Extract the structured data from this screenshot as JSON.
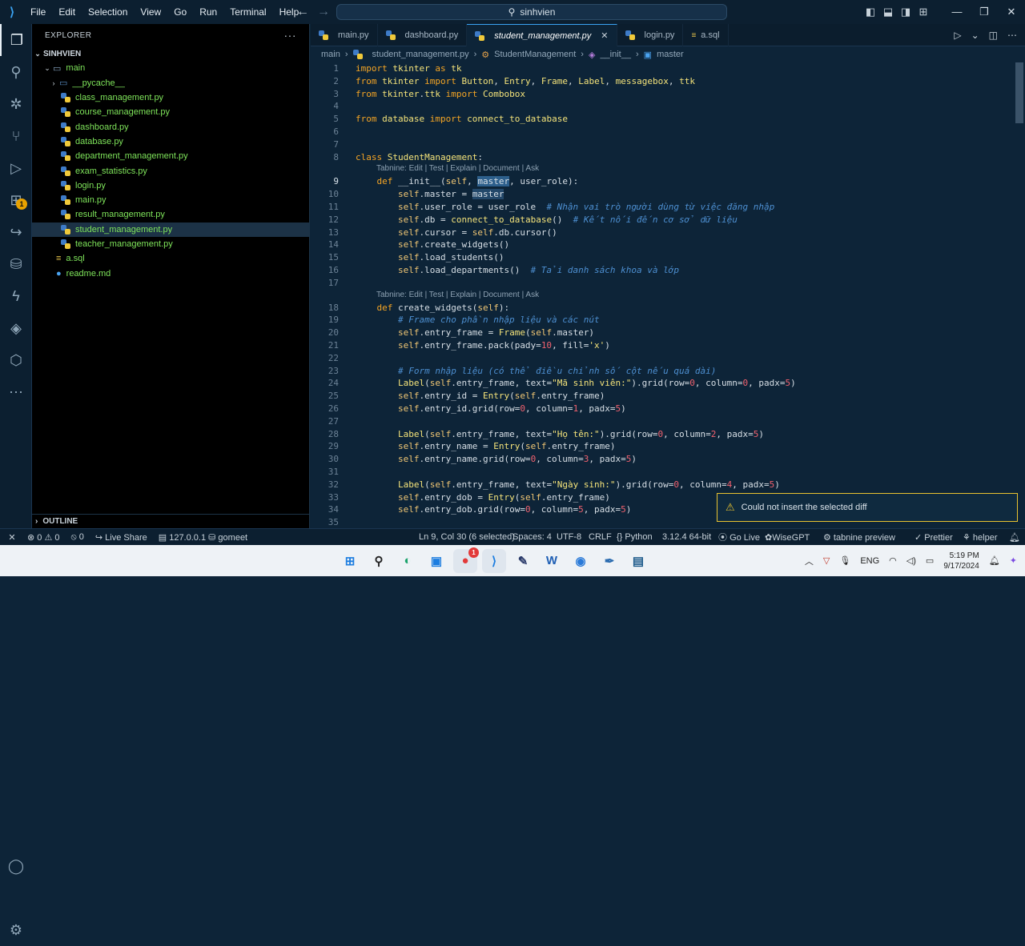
{
  "titlebar": {
    "menu": [
      "File",
      "Edit",
      "Selection",
      "View",
      "Go",
      "Run",
      "Terminal",
      "Help"
    ],
    "search": "sinhvien"
  },
  "sidebar": {
    "title": "EXPLORER",
    "more": "···",
    "root": "SINHVIEN",
    "folder": "main",
    "pycache": "__pycache__",
    "files": [
      "class_management.py",
      "course_management.py",
      "dashboard.py",
      "database.py",
      "department_management.py",
      "exam_statistics.py",
      "login.py",
      "main.py",
      "result_management.py",
      "student_management.py",
      "teacher_management.py"
    ],
    "root_files": [
      "a.sql",
      "readme.md"
    ],
    "outline": "OUTLINE"
  },
  "activity_badge": "1",
  "tabs": [
    "main.py",
    "dashboard.py",
    "student_management.py",
    "login.py",
    "a.sql"
  ],
  "breadcrumb": [
    "main",
    "student_management.py",
    "StudentManagement",
    "__init__",
    "master"
  ],
  "code_lens": "Tabnine: Edit | Test | Explain | Document | Ask",
  "code_lines": [
    "import tkinter as tk",
    "from tkinter import Button, Entry, Frame, Label, messagebox, ttk",
    "from tkinter.ttk import Combobox",
    "",
    "from database import connect_to_database",
    "",
    "",
    "class StudentManagement:",
    "    def __init__(self, master, user_role):",
    "        self.master = master",
    "        self.user_role = user_role  # Nhận vai trò người dùng từ việc đăng nhập",
    "        self.db = connect_to_database()  # Kết nối đến cơ sở dữ liệu",
    "        self.cursor = self.db.cursor()",
    "        self.create_widgets()",
    "        self.load_students()",
    "        self.load_departments()  # Tải danh sách khoa và lớp",
    "",
    "    def create_widgets(self):",
    "        # Frame cho phần nhập liệu và các nút",
    "        self.entry_frame = Frame(self.master)",
    "        self.entry_frame.pack(pady=10, fill='x')",
    "",
    "        # Form nhập liệu (có thể điều chỉnh số cột nếu quá dài)",
    "        Label(self.entry_frame, text=\"Mã sinh viên:\").grid(row=0, column=0, padx=5)",
    "        self.entry_id = Entry(self.entry_frame)",
    "        self.entry_id.grid(row=0, column=1, padx=5)",
    "",
    "        Label(self.entry_frame, text=\"Họ tên:\").grid(row=0, column=2, padx=5)",
    "        self.entry_name = Entry(self.entry_frame)",
    "        self.entry_name.grid(row=0, column=3, padx=5)",
    "",
    "        Label(self.entry_frame, text=\"Ngày sinh:\").grid(row=0, column=4, padx=5)",
    "        self.entry_dob = Entry(self.entry_frame)",
    "        self.entry_dob.grid(row=0, column=5, padx=5)",
    ""
  ],
  "notification": "Could not insert the selected diff",
  "statusbar": {
    "errors": "0",
    "warnings": "0",
    "ports": "0",
    "live_share": "Live Share",
    "host": "127.0.0.1",
    "db": "gomeet",
    "position": "Ln 9, Col 30 (6 selected)",
    "spaces": "Spaces: 4",
    "encoding": "UTF-8",
    "eol": "CRLF",
    "language": "Python",
    "interpreter": "3.12.4 64-bit",
    "golive": "Go Live",
    "wisegpt": "WiseGPT",
    "tabnine": "tabnine preview",
    "prettier": "Prettier",
    "helper": "helper"
  },
  "taskbar": {
    "lang": "ENG",
    "time": "5:19 PM",
    "date": "9/17/2024",
    "notif_badge": "1"
  }
}
